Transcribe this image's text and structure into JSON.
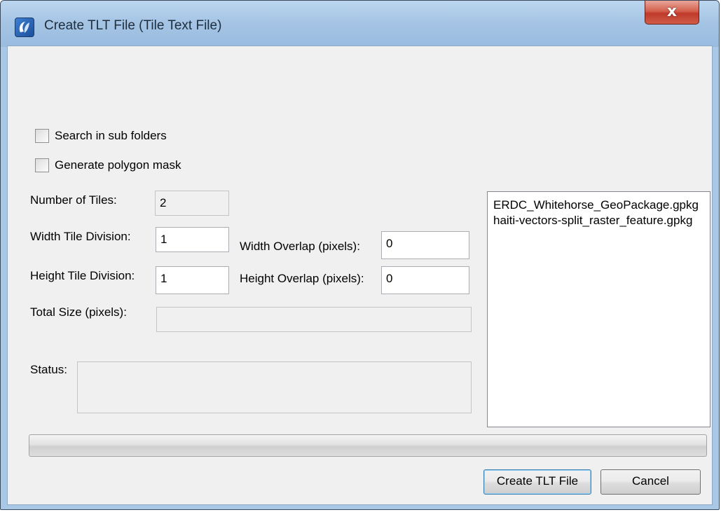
{
  "window": {
    "title": "Create TLT File (Tile Text File)",
    "close_label": "x"
  },
  "options": {
    "search_subfolders": {
      "label": "Search in sub folders",
      "checked": false
    },
    "generate_mask": {
      "label": "Generate polygon mask",
      "checked": false
    }
  },
  "form": {
    "num_tiles_label": "Number of Tiles:",
    "num_tiles_value": "2",
    "width_division_label": "Width Tile Division:",
    "width_division_value": "1",
    "width_overlap_label": "Width Overlap (pixels):",
    "width_overlap_value": "0",
    "height_division_label": "Height Tile Division:",
    "height_division_value": "1",
    "height_overlap_label": "Height Overlap (pixels):",
    "height_overlap_value": "0",
    "total_size_label": "Total Size (pixels):",
    "total_size_value": "",
    "status_label": "Status:",
    "status_value": ""
  },
  "files": [
    "ERDC_Whitehorse_GeoPackage.gpkg",
    "haiti-vectors-split_raster_feature.gpkg"
  ],
  "progress": {
    "value": 0
  },
  "buttons": {
    "create": "Create TLT File",
    "cancel": "Cancel"
  }
}
